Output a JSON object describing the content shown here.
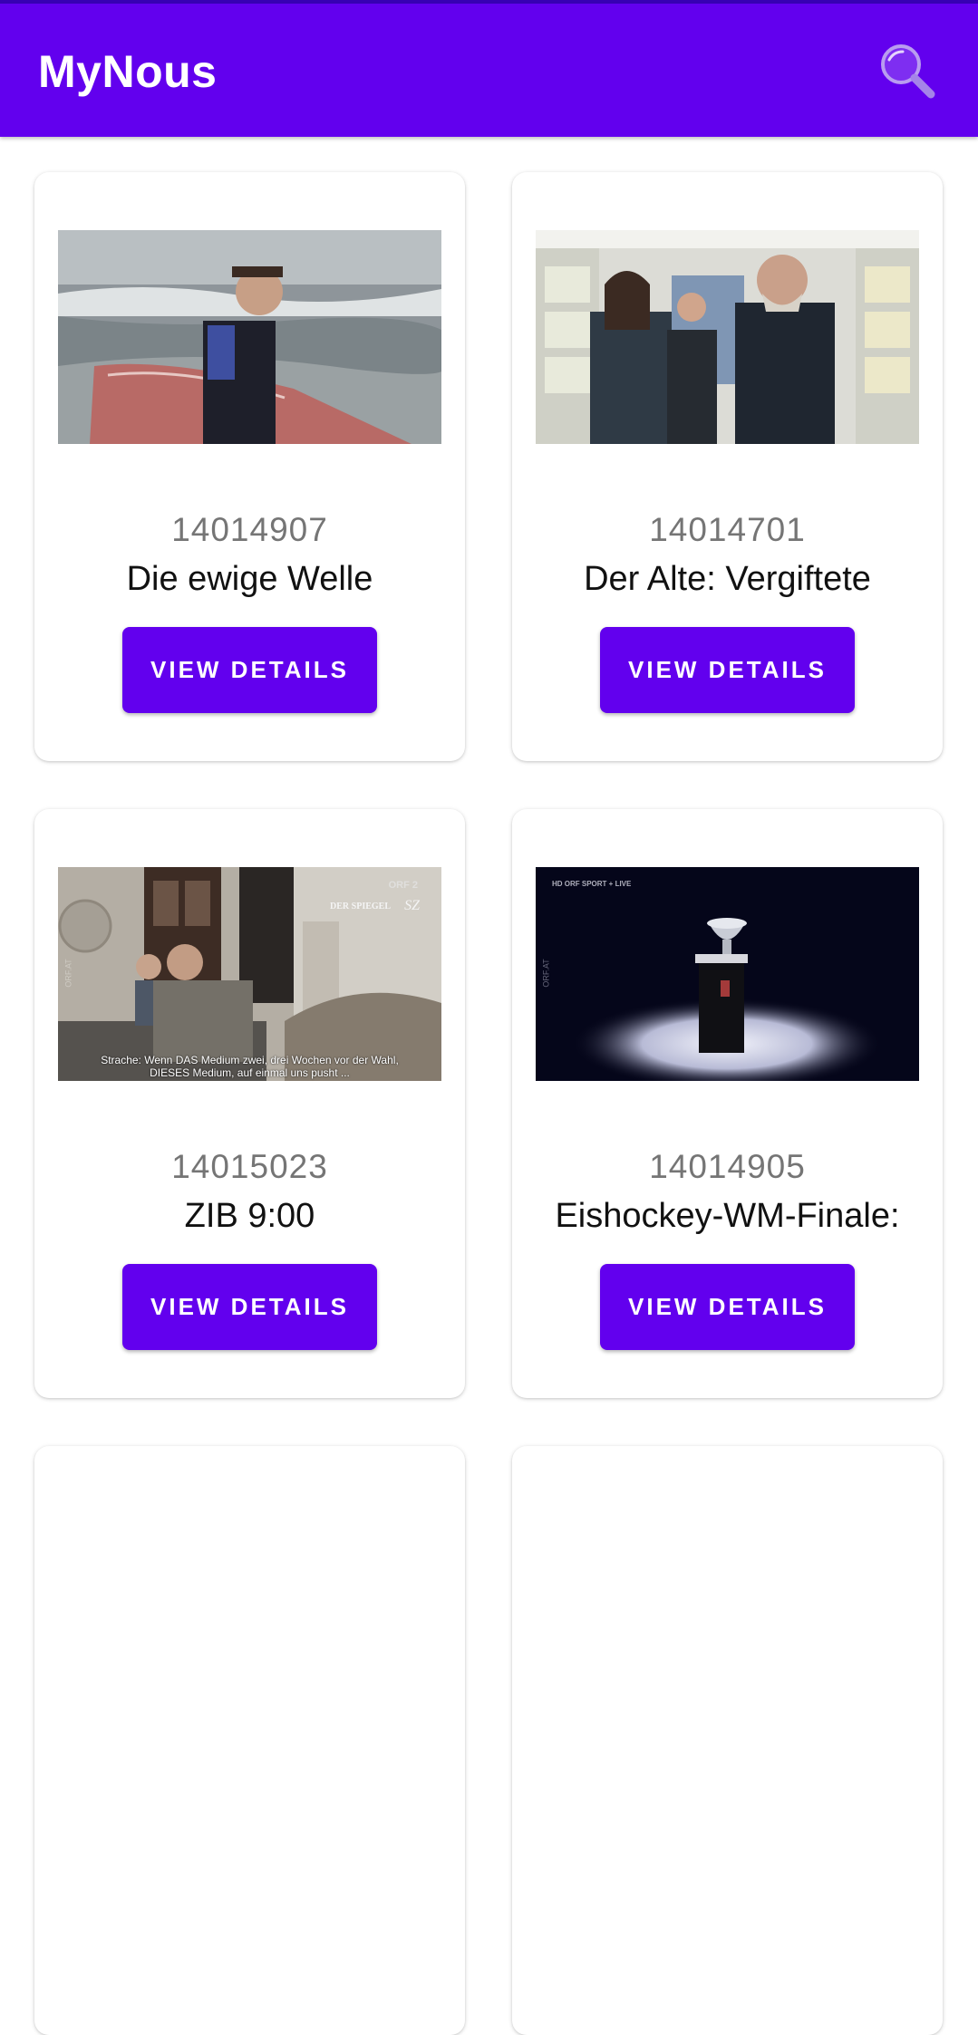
{
  "app_bar": {
    "title": "MyNous",
    "search_icon": "search-icon",
    "color": "#6200ee"
  },
  "cards": [
    {
      "id": "14014907",
      "title": "Die ewige Welle",
      "button_label": "VIEW DETAILS",
      "thumbnail": "surfer-on-beach-photo"
    },
    {
      "id": "14014701",
      "title": "Der Alte: Vergiftete",
      "button_label": "VIEW DETAILS",
      "thumbnail": "detectives-in-corridor-photo"
    },
    {
      "id": "14015023",
      "title": "ZIB 9:00",
      "button_label": "VIEW DETAILS",
      "thumbnail": "news-video-still",
      "overlay": {
        "logo": "ORF 2",
        "source": "DER SPIEGEL",
        "source2": "SZ",
        "side": "ORF.AT",
        "subtitle_line1": "Strache: Wenn DAS Medium zwei, drei Wochen vor der Wahl,",
        "subtitle_line2": "DIESES Medium, auf einmal uns pusht ..."
      }
    },
    {
      "id": "14014905",
      "title": "Eishockey-WM-Finale:",
      "button_label": "VIEW DETAILS",
      "thumbnail": "trophy-on-pedestal-still",
      "overlay": {
        "logo": "HD ORF SPORT + LIVE",
        "side": "ORF.AT"
      }
    }
  ]
}
